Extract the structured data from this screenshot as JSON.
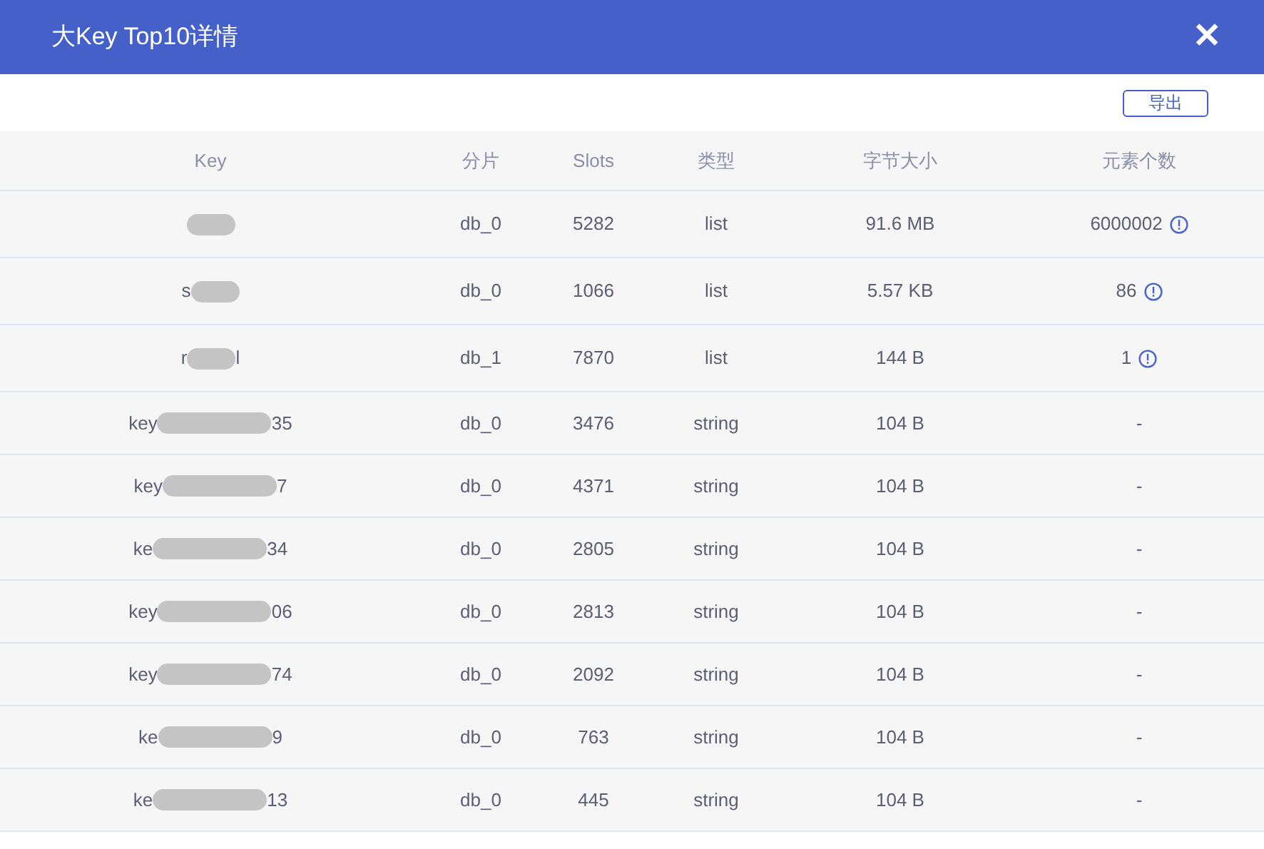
{
  "dialog": {
    "title": "大Key Top10详情",
    "close": "✕"
  },
  "toolbar": {
    "export_button": "导出"
  },
  "table": {
    "columns": [
      "Key",
      "分片",
      "Slots",
      "类型",
      "字节大小",
      "元素个数"
    ],
    "rows": [
      {
        "key": {
          "kind": "short"
        },
        "shard": "db_0",
        "slot": "5282",
        "type": "list",
        "size": "91.6 MB",
        "elements": "6000002",
        "info": true
      },
      {
        "key": {
          "start": "s",
          "kind": "short"
        },
        "shard": "db_0",
        "slot": "1066",
        "type": "list",
        "size": "5.57 KB",
        "elements": "86",
        "info": true
      },
      {
        "key": {
          "start": "r",
          "end": "l",
          "kind": "short"
        },
        "shard": "db_1",
        "slot": "7870",
        "type": "list",
        "size": "144 B",
        "elements": "1",
        "info": true
      },
      {
        "key": {
          "start": "key",
          "end": "35",
          "kind": "long"
        },
        "shard": "db_0",
        "slot": "3476",
        "type": "string",
        "size": "104 B",
        "elements": "-",
        "info": false
      },
      {
        "key": {
          "start": "key",
          "end": "7",
          "kind": "long"
        },
        "shard": "db_0",
        "slot": "4371",
        "type": "string",
        "size": "104 B",
        "elements": "-",
        "info": false
      },
      {
        "key": {
          "start": "ke",
          "end": "34",
          "kind": "long"
        },
        "shard": "db_0",
        "slot": "2805",
        "type": "string",
        "size": "104 B",
        "elements": "-",
        "info": false
      },
      {
        "key": {
          "start": "key",
          "end": "06",
          "kind": "long"
        },
        "shard": "db_0",
        "slot": "2813",
        "type": "string",
        "size": "104 B",
        "elements": "-",
        "info": false
      },
      {
        "key": {
          "start": "key",
          "end": "74",
          "kind": "long"
        },
        "shard": "db_0",
        "slot": "2092",
        "type": "string",
        "size": "104 B",
        "elements": "-",
        "info": false
      },
      {
        "key": {
          "start": "ke",
          "end": "9",
          "kind": "long"
        },
        "shard": "db_0",
        "slot": "763",
        "type": "string",
        "size": "104 B",
        "elements": "-",
        "info": false
      },
      {
        "key": {
          "start": "ke",
          "end": "13",
          "kind": "long"
        },
        "shard": "db_0",
        "slot": "445",
        "type": "string",
        "size": "104 B",
        "elements": "-",
        "info": false
      }
    ]
  }
}
